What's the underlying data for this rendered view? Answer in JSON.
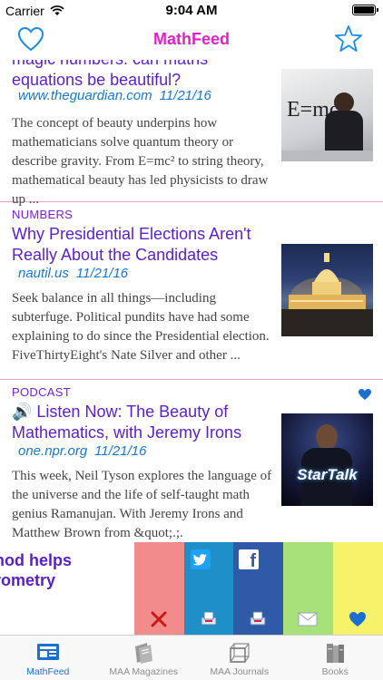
{
  "status_bar": {
    "carrier": "Carrier",
    "time": "9:04 AM"
  },
  "navbar": {
    "title": "MathFeed",
    "left_icon": "heart-outline-icon",
    "right_icon": "star-outline-icon"
  },
  "articles": [
    {
      "headline_partial_top": "magic numbers: can maths",
      "headline": "equations be beautiful?",
      "source": "www.theguardian.com",
      "date": "11/21/16",
      "summary": "The concept of beauty underpins how mathematicians solve quantum theory or describe gravity. From E=mc² to string theory, mathematical beauty has led physicists to draw up ...",
      "thumb_caption": "E=mc²"
    },
    {
      "category": "NUMBERS",
      "headline": "Why Presidential Elections Aren't Really About the Candidates",
      "source": "nautil.us",
      "date": "11/21/16",
      "summary": "Seek balance in all things—including subterfuge. Political pundits have had some explaining to do since the Presidential election. FiveThirtyEight's Nate Silver and other ..."
    },
    {
      "category": "PODCAST",
      "headline": "🔊 Listen Now: The Beauty of Mathematics, with Jeremy Irons",
      "source": "one.npr.org",
      "date": "11/21/16",
      "summary": "This week, Neil Tyson explores the language of the universe and the life of self-taught math genius Ramanujan. With Jeremy Irons and Matthew Brown from &quot;.;.",
      "thumb_caption": "StarTalk"
    }
  ],
  "swipe_row": {
    "text_line1": "hod helps",
    "text_line2": "rometry",
    "actions": [
      {
        "name": "delete-action",
        "icon": "close-x-icon",
        "color": "#f28b8b"
      },
      {
        "name": "twitter-action",
        "icon": "twitter-icon",
        "color": "#1f8fc8"
      },
      {
        "name": "facebook-action",
        "icon": "facebook-icon",
        "color": "#2f5aa8"
      },
      {
        "name": "email-action",
        "icon": "mail-icon",
        "color": "#a8e07a"
      },
      {
        "name": "favorite-action",
        "icon": "heart-icon",
        "color": "#f7f26a"
      }
    ]
  },
  "tabbar": {
    "tabs": [
      {
        "label": "MathFeed",
        "icon": "newspaper-icon",
        "active": true
      },
      {
        "label": "MAA Magazines",
        "icon": "magazine-icon",
        "active": false
      },
      {
        "label": "MAA Journals",
        "icon": "cube-icon",
        "active": false
      },
      {
        "label": "Books",
        "icon": "books-icon",
        "active": false
      }
    ]
  },
  "colors": {
    "accent_pink": "#e020c8",
    "headline_purple": "#5a1fc9",
    "link_blue": "#1a78c8",
    "tint_blue": "#1a8ce0"
  }
}
